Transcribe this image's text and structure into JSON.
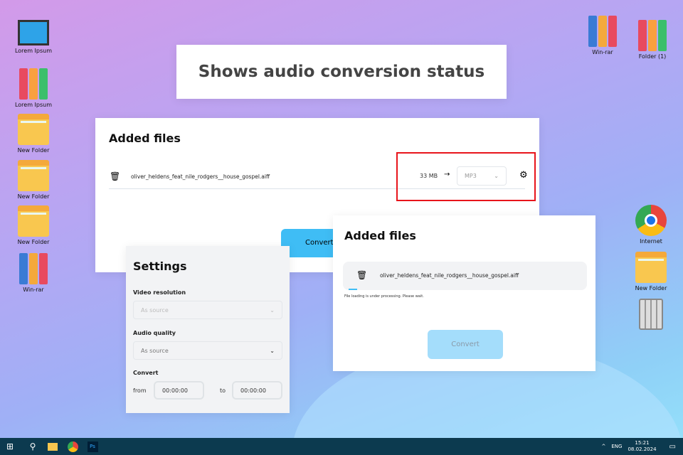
{
  "banner": {
    "title": "Shows audio conversion status"
  },
  "desktop_left": [
    {
      "label": "Lorem Ipsum",
      "icon": "computer-icon"
    },
    {
      "label": "Lorem Ipsum",
      "icon": "binders-icon"
    },
    {
      "label": "New Folder",
      "icon": "folder-icon"
    },
    {
      "label": "New Folder",
      "icon": "folder-icon"
    },
    {
      "label": "New Folder",
      "icon": "folder-icon"
    },
    {
      "label": "Win-rar",
      "icon": "winrar-icon"
    }
  ],
  "desktop_right": [
    {
      "label": "Win-rar",
      "icon": "winrar-icon"
    },
    {
      "label": "Folder (1)",
      "icon": "binders-icon"
    },
    {
      "label": "Internet",
      "icon": "chrome-icon"
    },
    {
      "label": "New Folder",
      "icon": "folder-icon"
    },
    {
      "label": "",
      "icon": "recycle-bin-icon"
    }
  ],
  "window1": {
    "title": "Added files",
    "file": "oliver_heldens_feat_nile_rodgers__house_gospel.aiff",
    "size": "33 MB",
    "format": "MP3",
    "convert": "Convert"
  },
  "settings": {
    "title": "Settings",
    "video_label": "Video resolution",
    "video_value": "As source",
    "audio_label": "Audio quality",
    "audio_value": "As source",
    "convert_label": "Convert",
    "from_label": "from",
    "from_value": "00:00:00",
    "to_label": "to",
    "to_value": "00:00:00"
  },
  "window2": {
    "title": "Added files",
    "file": "oliver_heldens_feat_nile_rodgers__house_gospel.aiff",
    "status": "File loading is under processing. Please wait.",
    "convert": "Convert"
  },
  "taskbar": {
    "lang": "ENG",
    "time": "15:21",
    "date": "08.02.2024"
  },
  "colors": {
    "highlight": "#e8141b",
    "accent": "#3fbdf5"
  }
}
